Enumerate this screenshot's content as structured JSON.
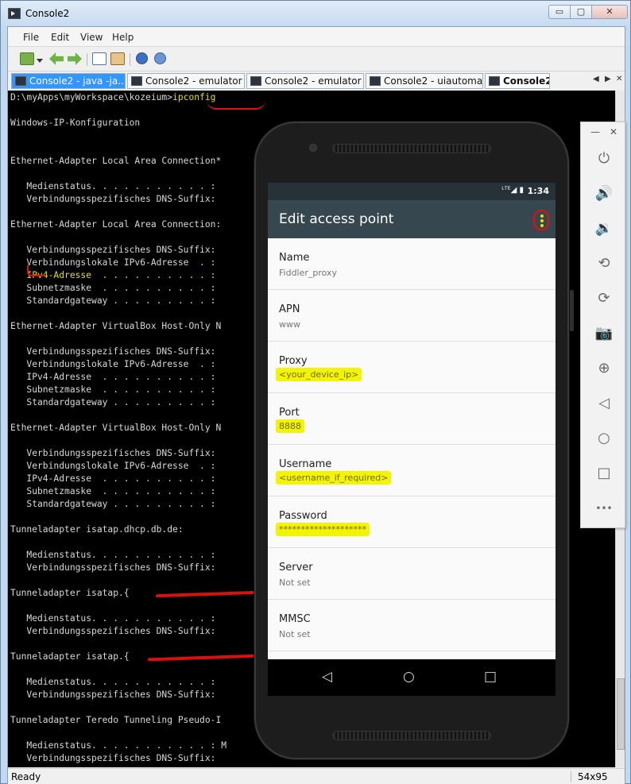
{
  "window": {
    "title": "Console2",
    "controls": {
      "minimize": "▭",
      "maximize": "▢",
      "close": "✕"
    }
  },
  "menu": [
    "File",
    "Edit",
    "View",
    "Help"
  ],
  "toolbar": {
    "icons": [
      "new-tab-icon",
      "dropdown-arrow-icon",
      "back-icon",
      "forward-icon",
      "copy-icon",
      "paste-icon",
      "info-icon",
      "help-icon"
    ]
  },
  "tabs": [
    {
      "label": "Console2 - java  -ja...",
      "state": "highlighted"
    },
    {
      "label": "Console2 - emulator ...",
      "state": "normal"
    },
    {
      "label": "Console2 - emulator ...",
      "state": "normal"
    },
    {
      "label": "Console2 - uiautomat...",
      "state": "normal"
    },
    {
      "label": "Console2",
      "state": "selected"
    }
  ],
  "tab_scroll": {
    "left": "◀",
    "right": "▶",
    "close": "✕"
  },
  "console": {
    "prompt": "D:\\myApps\\myWorkspace\\kozeium>",
    "command": "ipconfig",
    "lines": [
      "Windows-IP-Konfiguration",
      "Ethernet-Adapter Local Area Connection*",
      "   Medienstatus. . . . . . . . . . . :",
      "   Verbindungsspezifisches DNS-Suffix:",
      "Ethernet-Adapter Local Area Connection:",
      "   Verbindungsspezifisches DNS-Suffix:",
      "   Verbindungslokale IPv6-Adresse  . :",
      "   IPv4-Adresse  . . . . . . . . . . :",
      "   Subnetzmaske  . . . . . . . . . . :",
      "   Standardgateway . . . . . . . . . :",
      "Ethernet-Adapter VirtualBox Host-Only N",
      "   Verbindungsspezifisches DNS-Suffix:",
      "   Verbindungslokale IPv6-Adresse  . :",
      "   IPv4-Adresse  . . . . . . . . . . :",
      "   Subnetzmaske  . . . . . . . . . . :",
      "   Standardgateway . . . . . . . . . :",
      "Ethernet-Adapter VirtualBox Host-Only N",
      "   Verbindungsspezifisches DNS-Suffix:",
      "   Verbindungslokale IPv6-Adresse  . :",
      "   IPv4-Adresse  . . . . . . . . . . :",
      "   Subnetzmaske  . . . . . . . . . . :",
      "   Standardgateway . . . . . . . . . :",
      "Tunneladapter isatap.dhcp.db.de:",
      "   Medienstatus. . . . . . . . . . . :",
      "   Verbindungsspezifisches DNS-Suffix:",
      "Tunneladapter isatap.{",
      "   Medienstatus. . . . . . . . . . . :",
      "   Verbindungsspezifisches DNS-Suffix:",
      "Tunneladapter isatap.{",
      "   Medienstatus. . . . . . . . . . . :",
      "   Verbindungsspezifisches DNS-Suffix:",
      "Tunneladapter Teredo Tunneling Pseudo-I",
      "   Medienstatus. . . . . . . . . . . : M",
      "   Verbindungsspezifisches DNS-Suffix:"
    ]
  },
  "status": {
    "text": "Ready",
    "size": "54x95"
  },
  "phone": {
    "status_time": "1:34",
    "status_icons": "ᴸᵀᴱ◢ ▮",
    "screen_title": "Edit access point",
    "prefs": [
      {
        "label": "Name",
        "value": "Fiddler_proxy",
        "marked": false
      },
      {
        "label": "APN",
        "value": "www",
        "marked": false
      },
      {
        "label": "Proxy",
        "value": "<your_device_ip>",
        "marked": true
      },
      {
        "label": "Port",
        "value": "8888",
        "marked": true
      },
      {
        "label": "Username",
        "value": "<username_if_required>",
        "marked": true
      },
      {
        "label": "Password",
        "value": "********************",
        "marked": true
      },
      {
        "label": "Server",
        "value": "Not set",
        "marked": false
      },
      {
        "label": "MMSC",
        "value": "Not set",
        "marked": false
      }
    ],
    "nav": {
      "back": "◁",
      "home": "○",
      "recents": "□"
    }
  },
  "emulator_panel": {
    "minimize": "—",
    "close": "✕",
    "buttons": [
      {
        "name": "power-icon",
        "glyph": "⏻"
      },
      {
        "name": "volume-up-icon",
        "glyph": "🔊"
      },
      {
        "name": "volume-down-icon",
        "glyph": "🔉"
      },
      {
        "name": "rotate-left-icon",
        "glyph": "⟲"
      },
      {
        "name": "rotate-right-icon",
        "glyph": "⟳"
      },
      {
        "name": "camera-icon",
        "glyph": "📷"
      },
      {
        "name": "zoom-icon",
        "glyph": "⊕"
      },
      {
        "name": "back-icon",
        "glyph": "◁"
      },
      {
        "name": "home-icon",
        "glyph": "○"
      },
      {
        "name": "overview-icon",
        "glyph": "□"
      },
      {
        "name": "more-icon",
        "glyph": "•••"
      }
    ]
  },
  "colors": {
    "console_bg": "#000000",
    "console_text": "#d8d8d8",
    "highlight_yellow": "#e0e000",
    "annotation_red": "#e01010",
    "android_appbar": "#37474f",
    "android_statusbar": "#263238"
  }
}
